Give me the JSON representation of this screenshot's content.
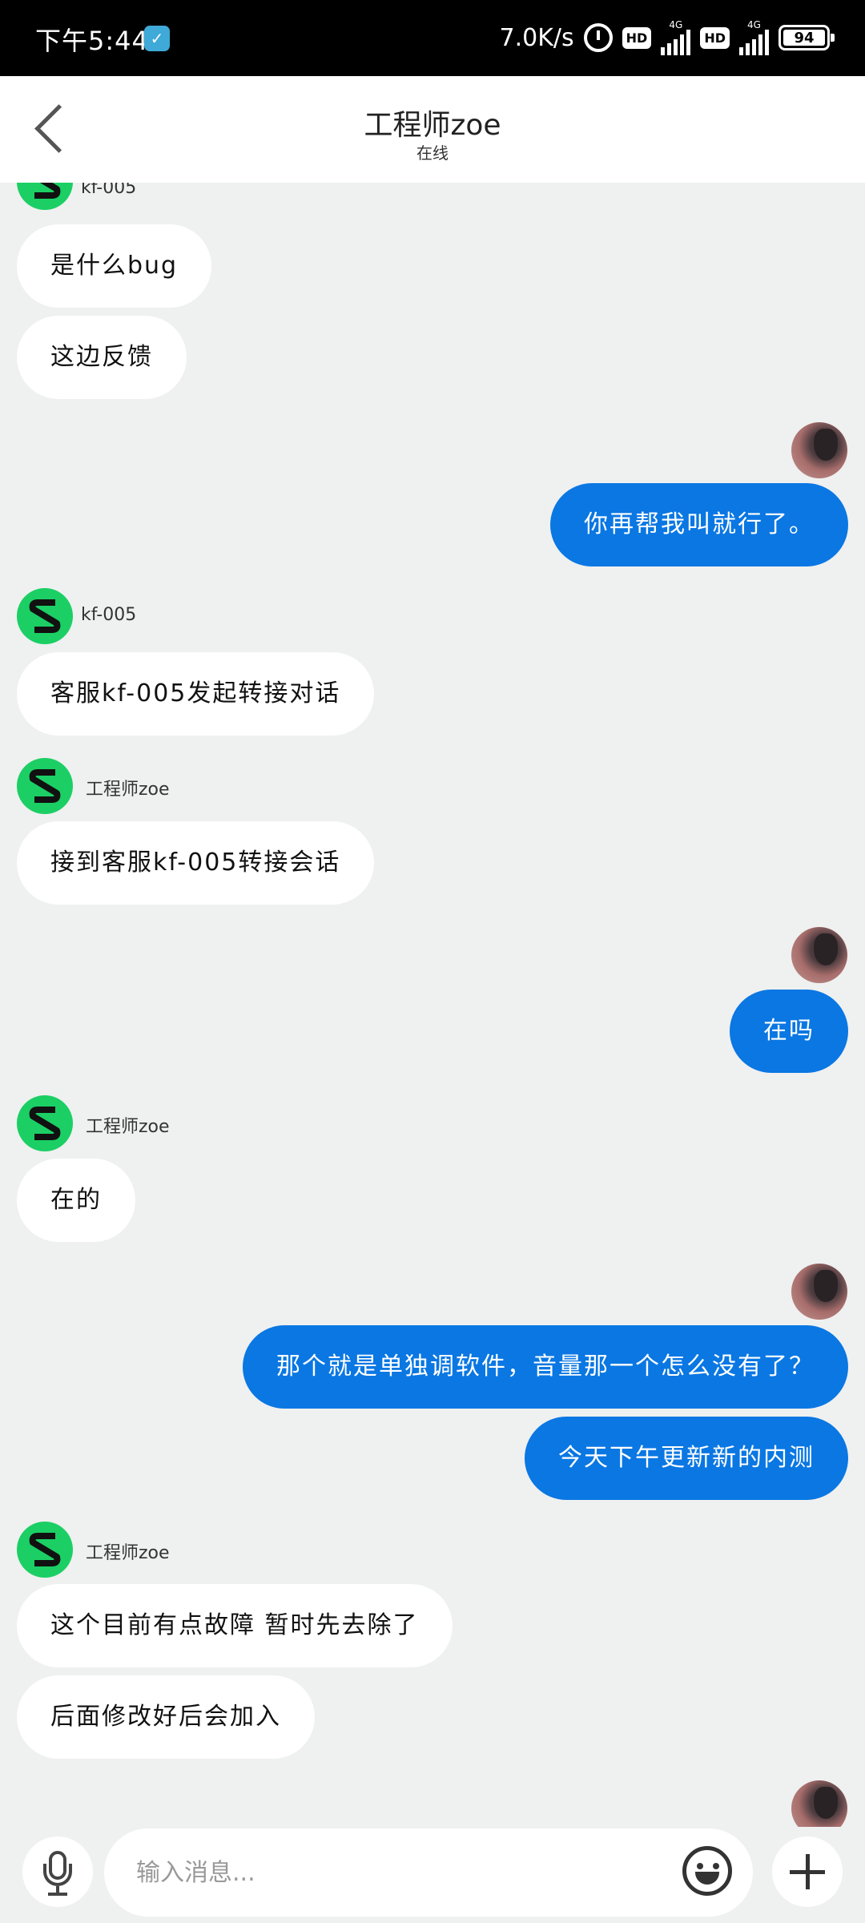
{
  "status_bar": {
    "time": "下午5:44",
    "net_speed": "7.0K/s",
    "hd_label": "HD",
    "net_type": "4G",
    "battery": "94"
  },
  "header": {
    "title": "工程师zoe",
    "subtitle": "在线"
  },
  "messages": [
    {
      "direction": "in",
      "sender": "kf-005"
    },
    {
      "direction": "in",
      "text": "是什么bug"
    },
    {
      "direction": "in",
      "text": "这边反馈"
    },
    {
      "direction": "out",
      "text": "你再帮我叫就行了。"
    },
    {
      "direction": "in",
      "sender": "kf-005",
      "text": "客服kf-005发起转接对话"
    },
    {
      "direction": "in",
      "sender": "工程师zoe",
      "text": "接到客服kf-005转接会话"
    },
    {
      "direction": "out",
      "text": "在吗"
    },
    {
      "direction": "in",
      "sender": "工程师zoe",
      "text": "在的"
    },
    {
      "direction": "out",
      "text": "那个就是单独调软件，音量那一个怎么没有了？"
    },
    {
      "direction": "out",
      "text": "今天下午更新新的内测"
    },
    {
      "direction": "in",
      "sender": "工程师zoe",
      "text": "这个目前有点故障 暂时先去除了"
    },
    {
      "direction": "in",
      "text": "后面修改好后会加入"
    }
  ],
  "input": {
    "placeholder": "输入消息..."
  },
  "icons": {
    "back": "chevron-left-icon",
    "mic": "microphone-icon",
    "emoji": "smiley-icon",
    "plus": "plus-icon",
    "agent_avatar": "s-logo-icon"
  },
  "colors": {
    "outgoing_bubble": "#0a77e3",
    "incoming_bubble": "#ffffff",
    "background": "#eff0f0",
    "avatar_green": "#1bcf64"
  }
}
